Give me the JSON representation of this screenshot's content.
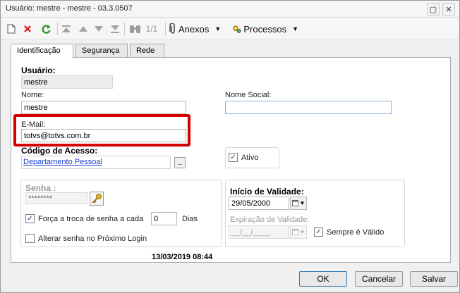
{
  "window": {
    "title": "Usuário: mestre - mestre - 03.3.0507",
    "maximize_glyph": "▢",
    "close_glyph": "✕"
  },
  "toolbar": {
    "page_counter": "1/1",
    "anexos_label": "Anexos",
    "processos_label": "Processos"
  },
  "tabs": [
    {
      "label": "Identificação"
    },
    {
      "label": "Segurança"
    },
    {
      "label": "Rede"
    }
  ],
  "form": {
    "usuario_label": "Usuário:",
    "usuario_value": "mestre",
    "nome_label": "Nome:",
    "nome_value": "mestre",
    "nome_social_label": "Nome Social:",
    "nome_social_value": "",
    "email_label": "E-Mail:",
    "email_value": "totvs@totvs.com.br",
    "codigo_acesso_label": "Código de Acesso:",
    "codigo_acesso_value": "Departamento Pessoal",
    "codigo_acesso_button": "...",
    "ativo_label": "Ativo",
    "ativo_checked": true,
    "senha_label": "Senha :",
    "senha_value": "********",
    "forca_troca_label": "Força a troca de senha a cada",
    "forca_troca_checked": true,
    "forca_troca_days": "0",
    "dias_label": "Dias",
    "alterar_senha_label": "Alterar senha no Próximo Login",
    "alterar_senha_checked": false,
    "inicio_validade_label": "Início de Validade:",
    "inicio_validade_value": "29/05/2000",
    "expiracao_label": "Expiração de Validade:",
    "expiracao_value": "__/__/____",
    "sempre_valido_label": "Sempre é Válido",
    "sempre_valido_checked": true,
    "datestamp": "13/03/2019 08:44"
  },
  "footer": {
    "ok_label": "OK",
    "cancel_label": "Cancelar",
    "save_label": "Salvar"
  },
  "colors": {
    "highlight": "#d40000",
    "link": "#1a3fd1",
    "accent": "#3c7fb1"
  }
}
